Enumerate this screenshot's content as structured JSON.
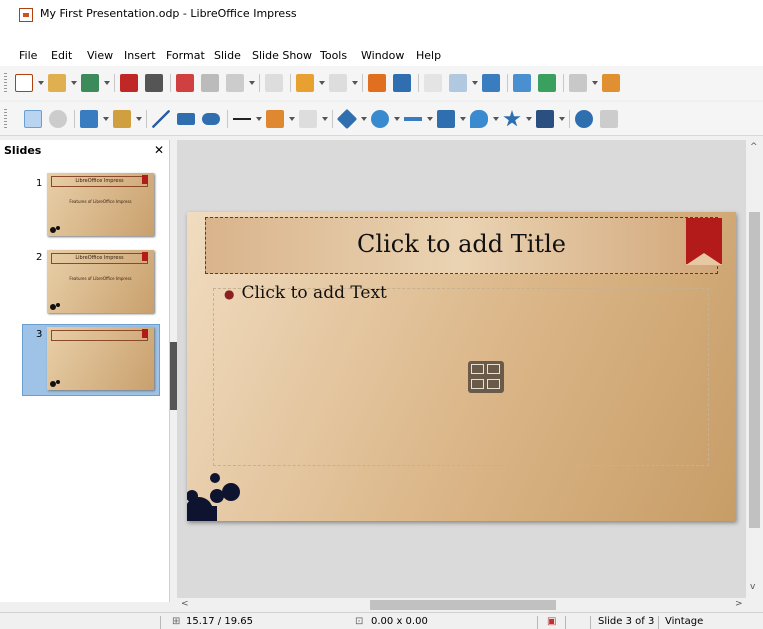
{
  "window": {
    "title": "My First Presentation.odp - LibreOffice Impress"
  },
  "menu": [
    "File",
    "Edit",
    "View",
    "Insert",
    "Format",
    "Slide",
    "Slide Show",
    "Tools",
    "Window",
    "Help"
  ],
  "slides_pane": {
    "header": "Slides",
    "close": "✕",
    "thumbs": [
      {
        "number": "1",
        "title": "LibreOffice Impress",
        "subtitle": "Features of LibreOffice Impress"
      },
      {
        "number": "2",
        "title": "LibreOffice Impress",
        "subtitle": "Features of LibreOffice Impress"
      },
      {
        "number": "3",
        "title": "",
        "subtitle": ""
      }
    ]
  },
  "slide": {
    "title_placeholder": "Click to add Title",
    "text_placeholder": "Click to add Text"
  },
  "statusbar": {
    "position": "15.17 / 19.65",
    "size": "0.00 x 0.00",
    "slide_info": "Slide 3 of 3",
    "master": "Vintage"
  },
  "colors": {
    "accent_red": "#b31b1b",
    "slide_tan": "#dbb688"
  }
}
